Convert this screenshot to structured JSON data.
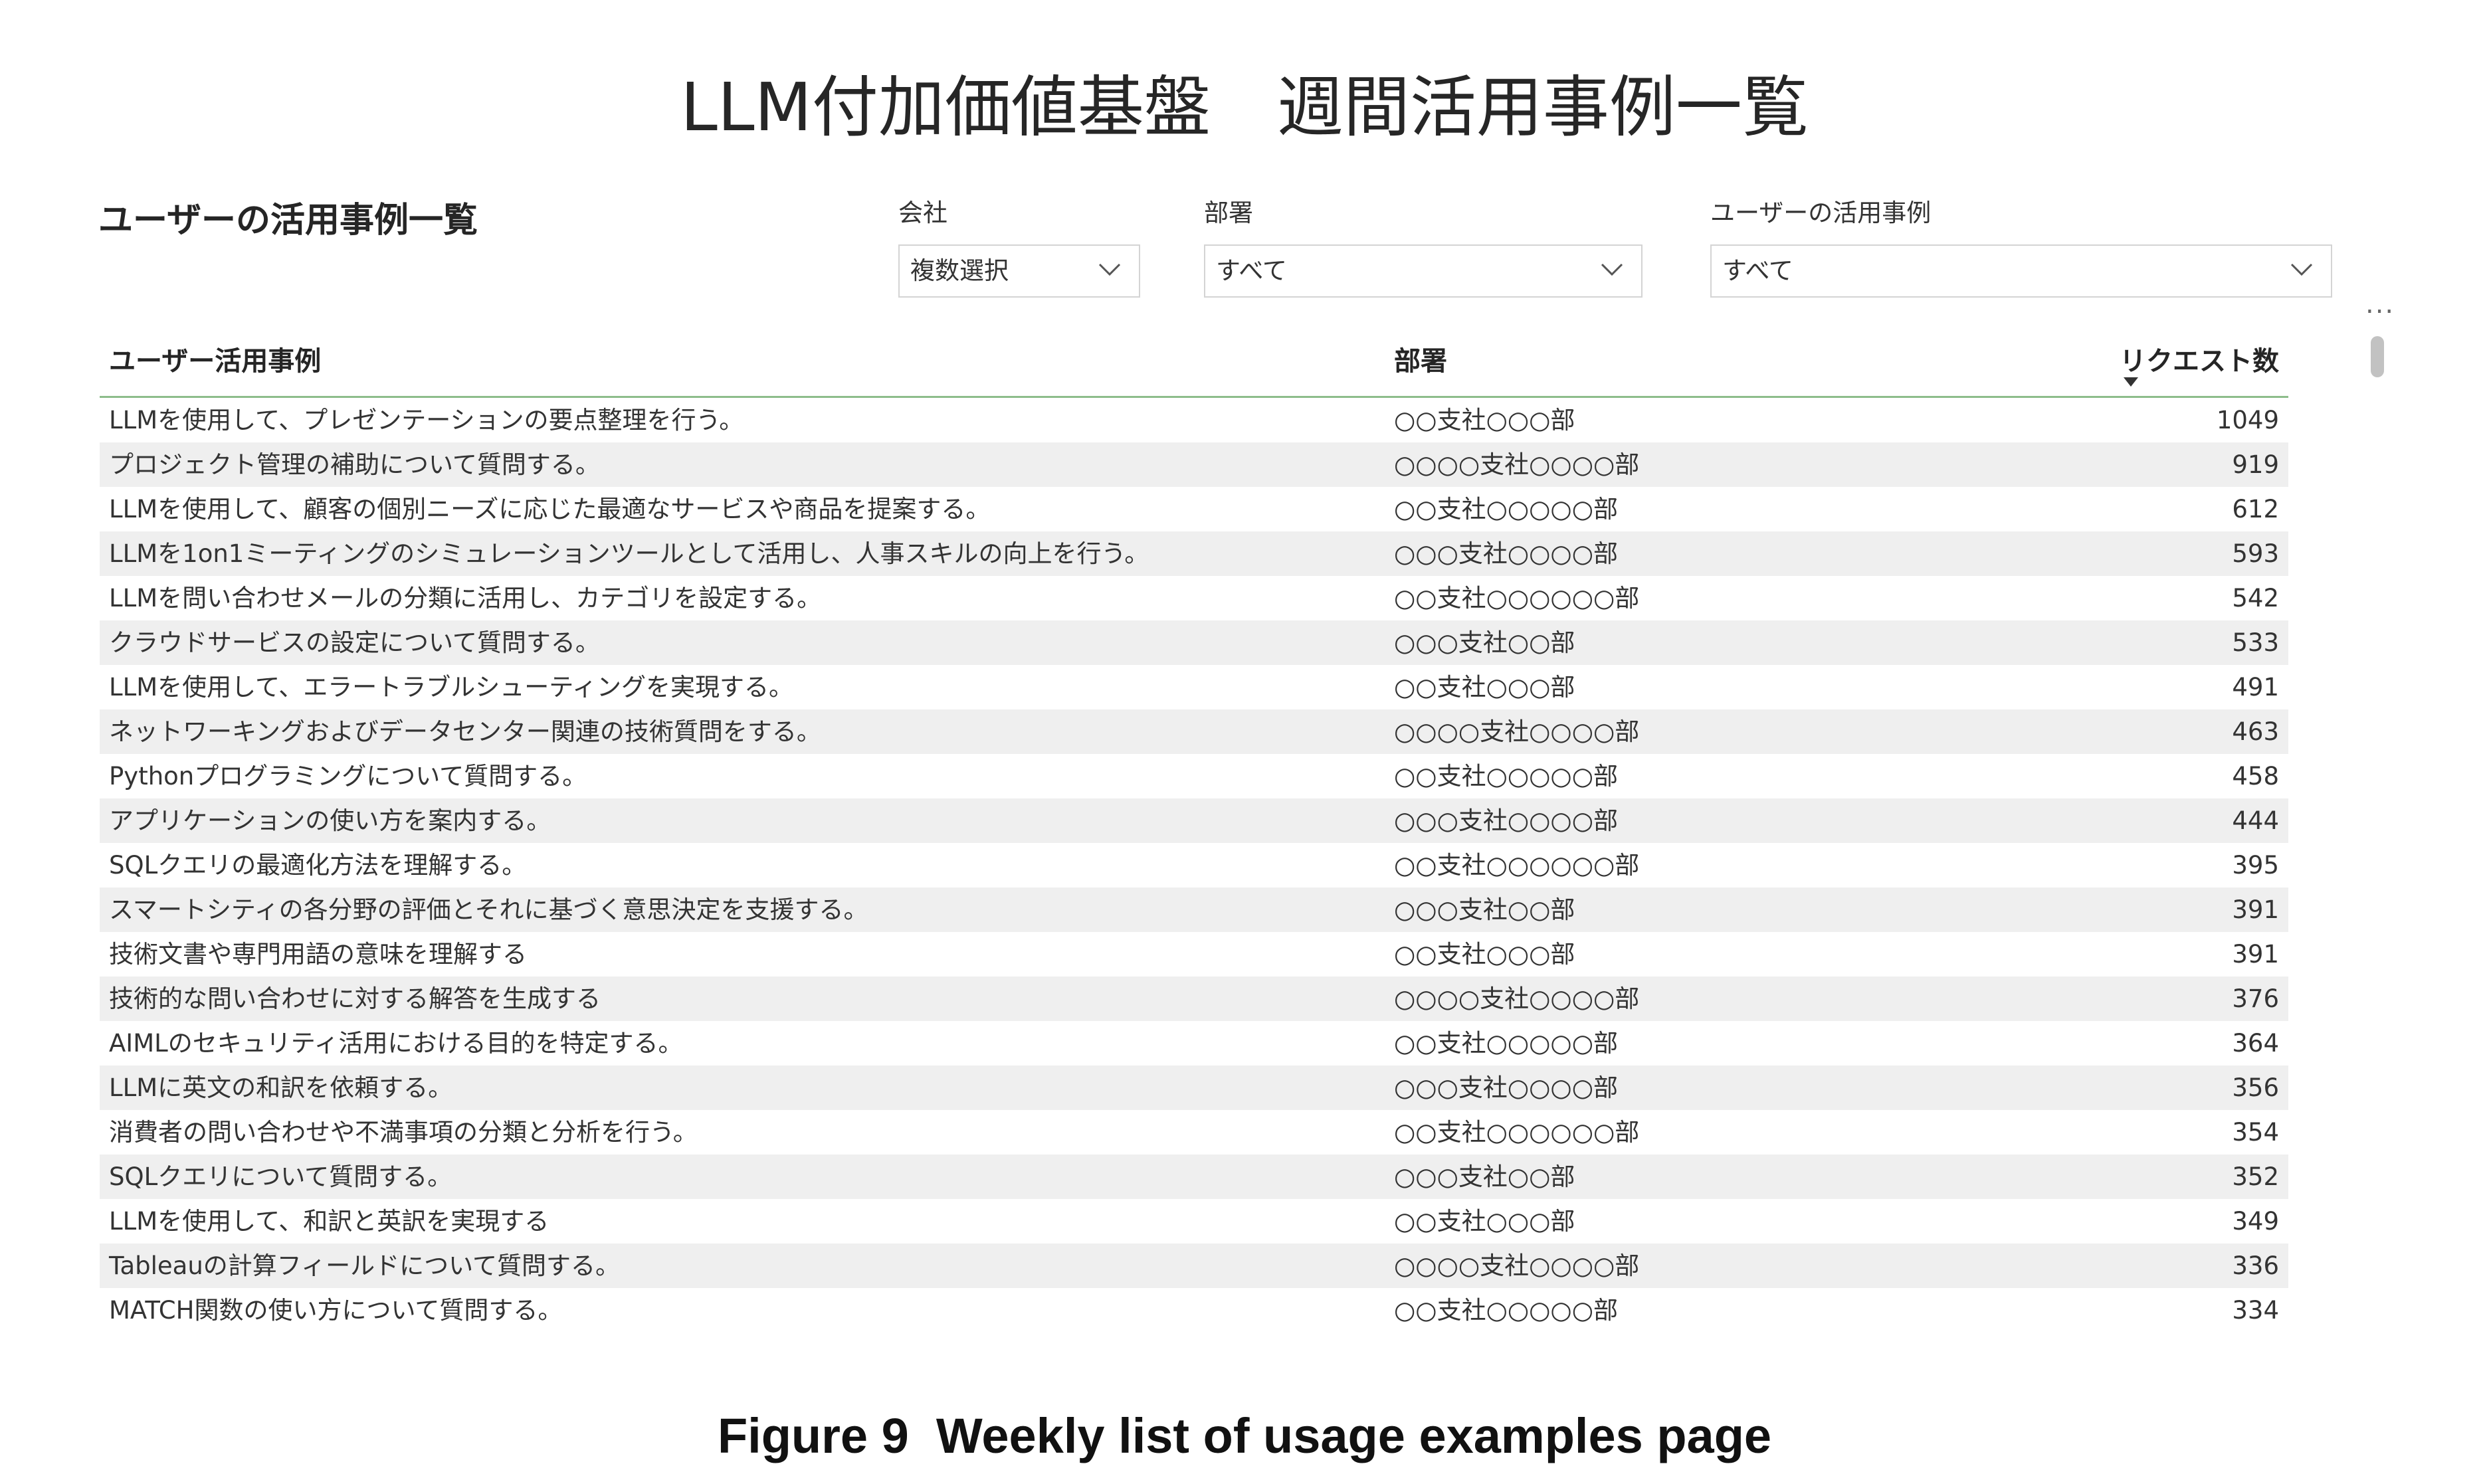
{
  "page": {
    "title": "LLM付加価値基盤　週間活用事例一覧",
    "section_title": "ユーザーの活用事例一覧",
    "caption": "Figure 9  Weekly list of usage examples page"
  },
  "filters": {
    "company": {
      "label": "会社",
      "value": "複数選択",
      "icon": "chevron-down-icon"
    },
    "department": {
      "label": "部署",
      "value": "すべて",
      "icon": "chevron-down-icon"
    },
    "usecase": {
      "label": "ユーザーの活用事例",
      "value": "すべて",
      "icon": "chevron-down-icon"
    }
  },
  "more_options": "...",
  "table": {
    "headers": {
      "usecase": "ユーザー活用事例",
      "department": "部署",
      "requests": "リクエスト数"
    },
    "sort": {
      "column": "requests",
      "direction": "descending"
    },
    "colors": {
      "header_rule": "#8dbd8b",
      "alt_row": "#efefef"
    },
    "rows": [
      {
        "usecase": "LLMを使用して、プレゼンテーションの要点整理を行う。",
        "department": "○○支社○○○部",
        "requests": "1049"
      },
      {
        "usecase": "プロジェクト管理の補助について質問する。",
        "department": "○○○○支社○○○○部",
        "requests": "919"
      },
      {
        "usecase": "LLMを使用して、顧客の個別ニーズに応じた最適なサービスや商品を提案する。",
        "department": "○○支社○○○○○部",
        "requests": "612"
      },
      {
        "usecase": "LLMを1on1ミーティングのシミュレーションツールとして活用し、人事スキルの向上を行う。",
        "department": "○○○支社○○○○部",
        "requests": "593"
      },
      {
        "usecase": "LLMを問い合わせメールの分類に活用し、カテゴリを設定する。",
        "department": "○○支社○○○○○○部",
        "requests": "542"
      },
      {
        "usecase": "クラウドサービスの設定について質問する。",
        "department": "○○○支社○○部",
        "requests": "533"
      },
      {
        "usecase": "LLMを使用して、エラートラブルシューティングを実現する。",
        "department": "○○支社○○○部",
        "requests": "491"
      },
      {
        "usecase": "ネットワーキングおよびデータセンター関連の技術質問をする。",
        "department": "○○○○支社○○○○部",
        "requests": "463"
      },
      {
        "usecase": "Pythonプログラミングについて質問する。",
        "department": "○○支社○○○○○部",
        "requests": "458"
      },
      {
        "usecase": "アプリケーションの使い方を案内する。",
        "department": "○○○支社○○○○部",
        "requests": "444"
      },
      {
        "usecase": "SQLクエリの最適化方法を理解する。",
        "department": "○○支社○○○○○○部",
        "requests": "395"
      },
      {
        "usecase": "スマートシティの各分野の評価とそれに基づく意思決定を支援する。",
        "department": "○○○支社○○部",
        "requests": "391"
      },
      {
        "usecase": "技術文書や専門用語の意味を理解する",
        "department": "○○支社○○○部",
        "requests": "391"
      },
      {
        "usecase": "技術的な問い合わせに対する解答を生成する",
        "department": "○○○○支社○○○○部",
        "requests": "376"
      },
      {
        "usecase": "AIMLのセキュリティ活用における目的を特定する。",
        "department": "○○支社○○○○○部",
        "requests": "364"
      },
      {
        "usecase": "LLMに英文の和訳を依頼する。",
        "department": "○○○支社○○○○部",
        "requests": "356"
      },
      {
        "usecase": "消費者の問い合わせや不満事項の分類と分析を行う。",
        "department": "○○支社○○○○○○部",
        "requests": "354"
      },
      {
        "usecase": "SQLクエリについて質問する。",
        "department": "○○○支社○○部",
        "requests": "352"
      },
      {
        "usecase": "LLMを使用して、和訳と英訳を実現する",
        "department": "○○支社○○○部",
        "requests": "349"
      },
      {
        "usecase": "Tableauの計算フィールドについて質問する。",
        "department": "○○○○支社○○○○部",
        "requests": "336"
      },
      {
        "usecase": "MATCH関数の使い方について質問する。",
        "department": "○○支社○○○○○部",
        "requests": "334"
      }
    ]
  }
}
